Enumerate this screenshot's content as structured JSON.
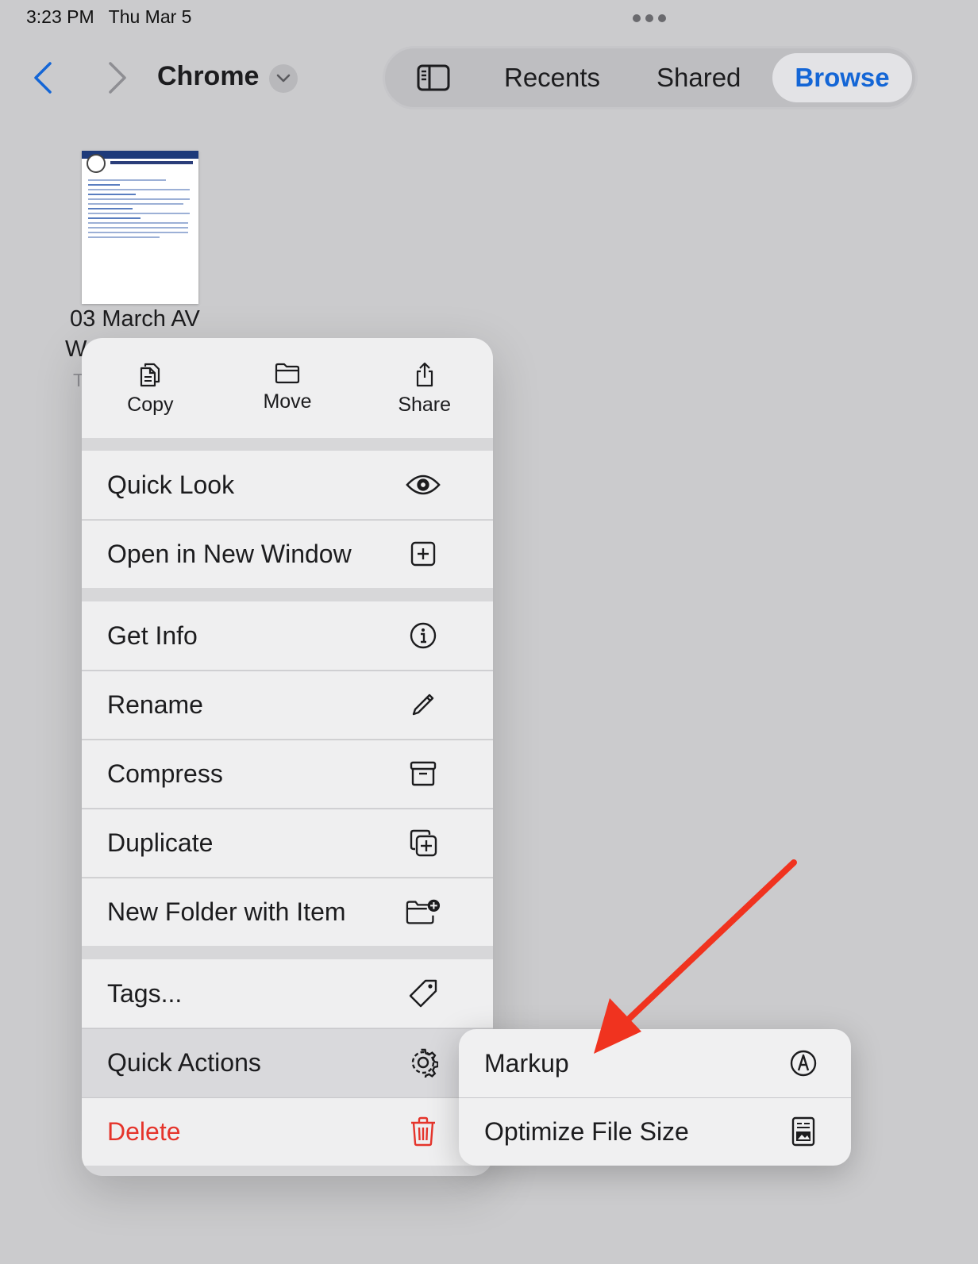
{
  "status_bar": {
    "time": "3:23 PM",
    "date": "Thu Mar 5"
  },
  "toolbar": {
    "title": "Chrome",
    "tabs": [
      {
        "label": "Recents"
      },
      {
        "label": "Shared"
      },
      {
        "label": "Browse",
        "selected": true
      }
    ],
    "accent_color": "#1466d6"
  },
  "file": {
    "name_line1": "03 March AV",
    "name_line2": "W",
    "subtitle": "T"
  },
  "context_menu": {
    "top_actions": [
      {
        "label": "Copy",
        "icon": "copy-icon"
      },
      {
        "label": "Move",
        "icon": "folder-icon"
      },
      {
        "label": "Share",
        "icon": "share-icon"
      }
    ],
    "items": [
      {
        "label": "Quick Look",
        "icon": "eye-icon"
      },
      {
        "label": "Open in New Window",
        "icon": "plus-square-icon"
      },
      {
        "label": "Get Info",
        "icon": "info-icon"
      },
      {
        "label": "Rename",
        "icon": "pencil-icon"
      },
      {
        "label": "Compress",
        "icon": "archive-box-icon"
      },
      {
        "label": "Duplicate",
        "icon": "duplicate-icon"
      },
      {
        "label": "New Folder with Item",
        "icon": "folder-badge-plus-icon"
      },
      {
        "label": "Tags...",
        "icon": "tag-icon"
      },
      {
        "label": "Quick Actions",
        "icon": "gear-icon",
        "highlighted": true
      },
      {
        "label": "Delete",
        "icon": "trash-icon",
        "destructive": true
      }
    ],
    "destructive_color": "#e5342b"
  },
  "quick_actions_submenu": {
    "items": [
      {
        "label": "Markup",
        "icon": "markup-pen-icon"
      },
      {
        "label": "Optimize File Size",
        "icon": "document-image-icon"
      }
    ]
  },
  "annotation": {
    "arrow_color": "#f0331f"
  }
}
